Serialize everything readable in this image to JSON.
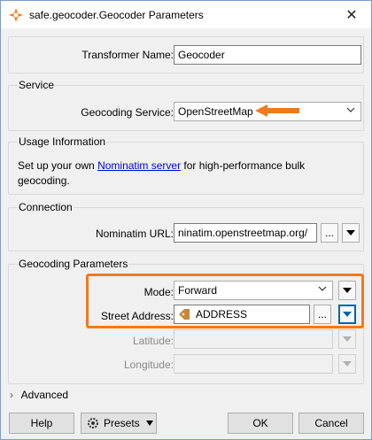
{
  "window": {
    "title": "safe.geocoder.Geocoder Parameters",
    "close_glyph": "✕"
  },
  "transformer_name": {
    "label": "Transformer Name:",
    "value": "Geocoder"
  },
  "service": {
    "group_title": "Service",
    "label": "Geocoding Service:",
    "value": "OpenStreetMap"
  },
  "usage": {
    "group_title": "Usage Information",
    "text_before": "Set up your own ",
    "link": "Nominatim server",
    "text_after": " for high-performance bulk geocoding."
  },
  "connection": {
    "group_title": "Connection",
    "label": "Nominatim URL:",
    "value": "ninatim.openstreetmap.org/",
    "ellipsis": "..."
  },
  "params": {
    "group_title": "Geocoding Parameters",
    "mode_label": "Mode:",
    "mode_value": "Forward",
    "street_label": "Street Address:",
    "street_value": "ADDRESS",
    "ellipsis": "...",
    "latitude_label": "Latitude:",
    "longitude_label": "Longitude:"
  },
  "advanced": {
    "label": "Advanced",
    "chevron": "›"
  },
  "buttons": {
    "help": "Help",
    "presets": "Presets",
    "ok": "OK",
    "cancel": "Cancel"
  },
  "colors": {
    "accent_orange": "#f07a1a",
    "link_blue": "#0000ee",
    "focus_blue": "#0063b1"
  }
}
